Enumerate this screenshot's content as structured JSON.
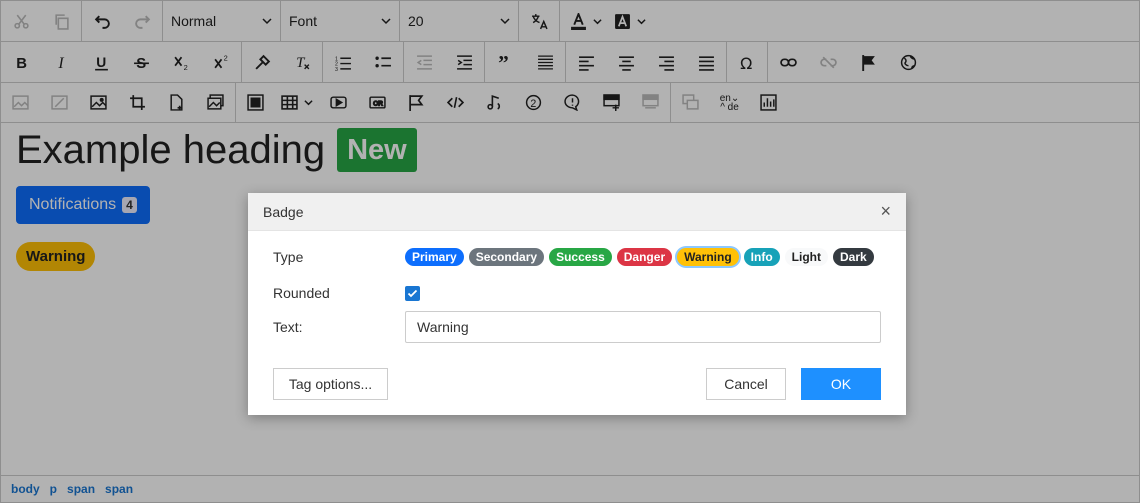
{
  "toolbar1": {
    "format": "Normal",
    "font": "Font",
    "size": "20"
  },
  "content": {
    "heading": "Example heading",
    "heading_badge": "New",
    "notifications_label": "Notifications",
    "notifications_count": "4",
    "warning_badge": "Warning"
  },
  "statusbar": [
    "body",
    "p",
    "span",
    "span"
  ],
  "dialog": {
    "title": "Badge",
    "close": "×",
    "type_label": "Type",
    "types": [
      {
        "label": "Primary",
        "bg": "#0d6efd",
        "fg": "#ffffff"
      },
      {
        "label": "Secondary",
        "bg": "#6c757d",
        "fg": "#ffffff"
      },
      {
        "label": "Success",
        "bg": "#28a745",
        "fg": "#ffffff"
      },
      {
        "label": "Danger",
        "bg": "#dc3545",
        "fg": "#ffffff"
      },
      {
        "label": "Warning",
        "bg": "#ffc107",
        "fg": "#222222"
      },
      {
        "label": "Info",
        "bg": "#17a2b8",
        "fg": "#ffffff"
      },
      {
        "label": "Light",
        "bg": "#f8f9fa",
        "fg": "#222222"
      },
      {
        "label": "Dark",
        "bg": "#343a40",
        "fg": "#ffffff"
      }
    ],
    "selected_type": "Warning",
    "rounded_label": "Rounded",
    "rounded_checked": true,
    "text_label": "Text:",
    "text_value": "Warning",
    "tag_options": "Tag options...",
    "cancel": "Cancel",
    "ok": "OK"
  }
}
